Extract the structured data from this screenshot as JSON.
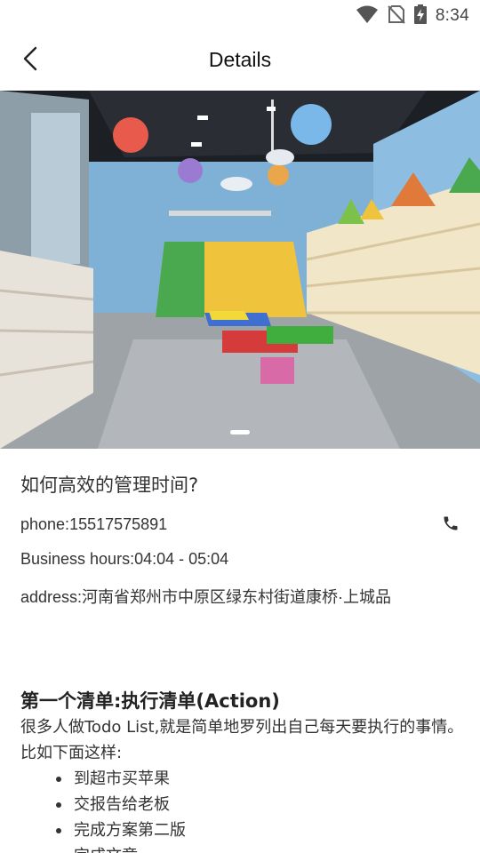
{
  "status_bar": {
    "time": "8:34",
    "icons": [
      "wifi-icon",
      "no-sim-icon",
      "battery-charging-icon"
    ]
  },
  "toolbar": {
    "back_icon": "chevron-left-icon",
    "title": "Details"
  },
  "banner": {
    "image": "children's library reading room with hot-air-balloon decorations, bookshelves, hexagon shelves and colorful tables",
    "page_indicator": {
      "current": 1
    }
  },
  "store": {
    "title": "如何高效的管理时间?",
    "phone_label": "phone:",
    "phone": "15517575891",
    "hours_label": "Business hours:",
    "hours": "04:04 - 05:04",
    "address_label": "address:",
    "address": "河南省郑州市中原区绿东村街道康桥·上城品",
    "phone_icon": "phone-icon"
  },
  "article": {
    "heading": "第一个清单:执行清单(Action)",
    "paragraph": "很多人做Todo List,就是简单地罗列出自己每天要执行的事情。比如下面这样:",
    "items": [
      "到超市买苹果",
      "交报告给老板",
      "完成方案第二版",
      "完成文章"
    ]
  }
}
